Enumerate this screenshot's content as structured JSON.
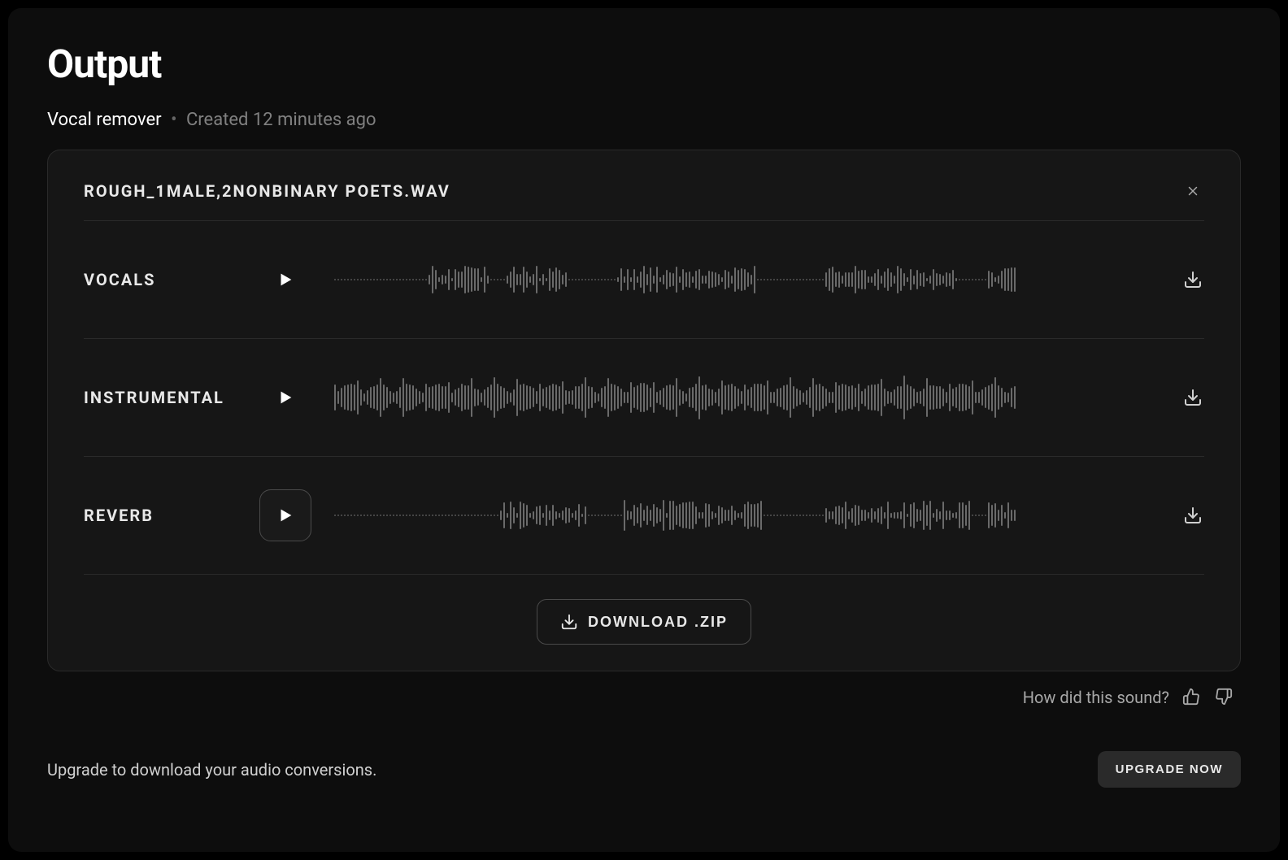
{
  "page": {
    "title": "Output"
  },
  "subtitle": {
    "tool": "Vocal remover",
    "created": "Created 12 minutes ago"
  },
  "card": {
    "filename": "ROUGH_1MALE,2NONBINARY POETS.WAV",
    "download_zip_label": "DOWNLOAD .ZIP"
  },
  "tracks": [
    {
      "label": "VOCALS",
      "active": false,
      "pattern": "sparse"
    },
    {
      "label": "INSTRUMENTAL",
      "active": false,
      "pattern": "dense"
    },
    {
      "label": "REVERB",
      "active": true,
      "pattern": "mid"
    }
  ],
  "feedback": {
    "prompt": "How did this sound?"
  },
  "upgrade": {
    "text": "Upgrade to download your audio conversions.",
    "button": "UPGRADE NOW"
  }
}
